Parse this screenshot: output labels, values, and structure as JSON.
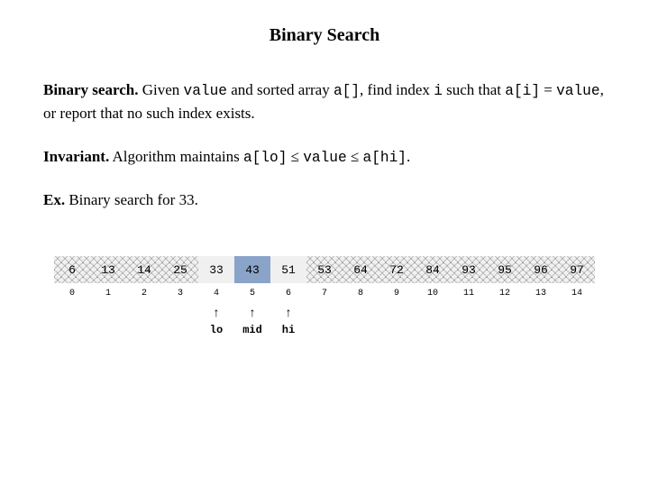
{
  "title": "Binary Search",
  "para1": {
    "lead": "Binary search.",
    "t1": " Given ",
    "c1": "value",
    "t2": " and sorted array ",
    "c2": "a[]",
    "t3": ", find index ",
    "c3": "i",
    "t4": " such that ",
    "c4": "a[i]",
    "t5": " = ",
    "c5": "value",
    "t6": ", or report that no such index exists."
  },
  "para2": {
    "lead": "Invariant.",
    "t1": " Algorithm maintains ",
    "c1": "a[lo]",
    "le1": " ≤ ",
    "c2": "value",
    "le2": " ≤ ",
    "c3": "a[hi]",
    "t2": "."
  },
  "para3": {
    "lead": "Ex.",
    "t1": " Binary search for 33."
  },
  "cells": [
    {
      "v": "6",
      "s": "hatched"
    },
    {
      "v": "13",
      "s": "hatched"
    },
    {
      "v": "14",
      "s": "hatched"
    },
    {
      "v": "25",
      "s": "hatched"
    },
    {
      "v": "33",
      "s": "plain"
    },
    {
      "v": "43",
      "s": "active"
    },
    {
      "v": "51",
      "s": "plain"
    },
    {
      "v": "53",
      "s": "hatched"
    },
    {
      "v": "64",
      "s": "hatched"
    },
    {
      "v": "72",
      "s": "hatched"
    },
    {
      "v": "84",
      "s": "hatched"
    },
    {
      "v": "93",
      "s": "hatched"
    },
    {
      "v": "95",
      "s": "hatched"
    },
    {
      "v": "96",
      "s": "hatched"
    },
    {
      "v": "97",
      "s": "hatched"
    }
  ],
  "indices": [
    "0",
    "1",
    "2",
    "3",
    "4",
    "5",
    "6",
    "7",
    "8",
    "9",
    "10",
    "11",
    "12",
    "13",
    "14"
  ],
  "pointers": {
    "lo": 4,
    "mid": 5,
    "hi": 6
  },
  "labels": {
    "lo": "lo",
    "mid": "mid",
    "hi": "hi"
  }
}
